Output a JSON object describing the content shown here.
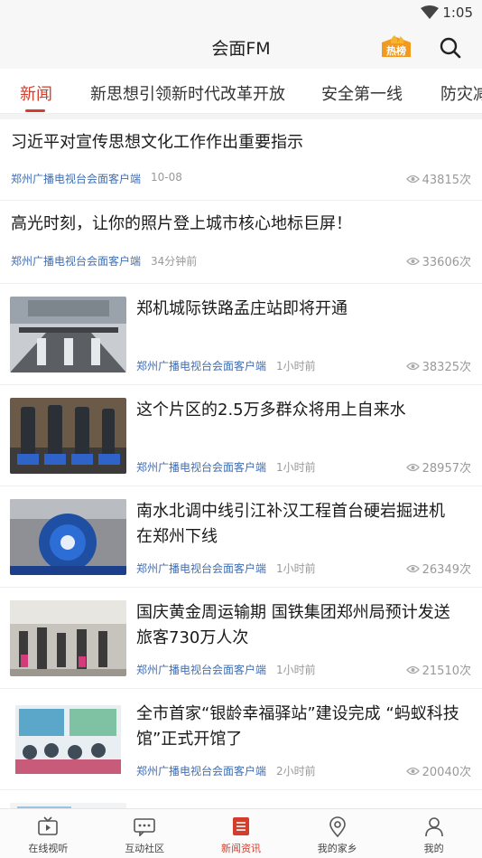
{
  "status": {
    "time": "1:05"
  },
  "header": {
    "title": "会面FM",
    "hot_badge": "热榜"
  },
  "tabs": [
    {
      "label": "新闻"
    },
    {
      "label": "新思想引领新时代改革开放"
    },
    {
      "label": "安全第一线"
    },
    {
      "label": "防灾减"
    }
  ],
  "news": [
    {
      "title_lines": [
        "习近平对宣传思想文化工作作出重要指示"
      ],
      "source": "郑州广播电视台会面客户端",
      "time": "10-08",
      "views": "43815次"
    },
    {
      "title_lines": [
        "高光时刻，让你的照片登上城市核心地标巨屏！"
      ],
      "source": "郑州广播电视台会面客户端",
      "time": "34分钟前",
      "views": "33606次"
    },
    {
      "title_lines": [
        "郑机城际铁路孟庄站即将开通"
      ],
      "source": "郑州广播电视台会面客户端",
      "time": "1小时前",
      "views": "38325次"
    },
    {
      "title_lines": [
        "这个片区的2.5万多群众将用上自来水"
      ],
      "source": "郑州广播电视台会面客户端",
      "time": "1小时前",
      "views": "28957次"
    },
    {
      "title_lines": [
        "南水北调中线引江补汉工程首台硬岩掘进机",
        "在郑州下线"
      ],
      "source": "郑州广播电视台会面客户端",
      "time": "1小时前",
      "views": "26349次"
    },
    {
      "title_lines": [
        "国庆黄金周运输期  国铁集团郑州局预计发送",
        "旅客730万人次"
      ],
      "source": "郑州广播电视台会面客户端",
      "time": "1小时前",
      "views": "21510次"
    },
    {
      "title_lines": [
        "全市首家“银龄幸福驿站”建设完成 “蚂蚁科技",
        "馆”正式开馆了"
      ],
      "source": "郑州广播电视台会面客户端",
      "time": "2小时前",
      "views": "20040次"
    }
  ],
  "bottom_nav": [
    {
      "label": "在线视听",
      "icon": "tv-icon"
    },
    {
      "label": "互动社区",
      "icon": "chat-icon"
    },
    {
      "label": "新闻资讯",
      "icon": "news-icon"
    },
    {
      "label": "我的家乡",
      "icon": "location-icon"
    },
    {
      "label": "我的",
      "icon": "user-icon"
    }
  ],
  "colors": {
    "accent": "#d43c2c",
    "source_blue": "#3f6fb5"
  }
}
